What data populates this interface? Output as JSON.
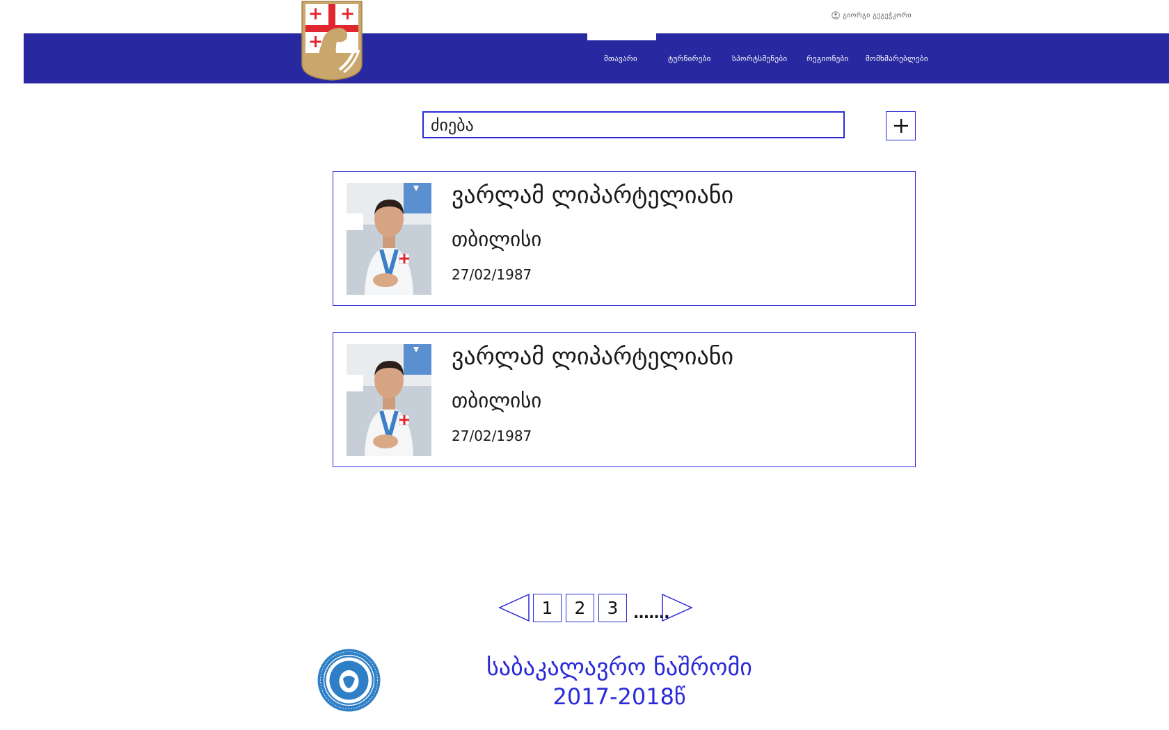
{
  "header": {
    "user_name": "გიორგი გეგეჭკორი",
    "nav": [
      {
        "label": "მთავარი",
        "active": true
      },
      {
        "label": "ტურნირები",
        "active": false
      },
      {
        "label": "სპორტსმენები",
        "active": false
      },
      {
        "label": "რეგიონები",
        "active": false
      },
      {
        "label": "მომხმარებლები",
        "active": false
      }
    ]
  },
  "search": {
    "placeholder": "ძიება",
    "add_label": "+"
  },
  "athletes": [
    {
      "name": "ვარლამ ლიპარტელიანი",
      "city": "თბილისი",
      "birth_date": "27/02/1987"
    },
    {
      "name": "ვარლამ ლიპარტელიანი",
      "city": "თბილისი",
      "birth_date": "27/02/1987"
    }
  ],
  "pagination": {
    "pages": [
      "1",
      "2",
      "3"
    ],
    "ellipsis": "......."
  },
  "footer": {
    "title": "საბაკალავრო ნაშრომი",
    "year": "2017-2018წ"
  },
  "colors": {
    "navbar": "#2828a0",
    "accent": "#2a2ad8",
    "crest_gold": "#c9a66b",
    "flag_red": "#e0262f"
  }
}
